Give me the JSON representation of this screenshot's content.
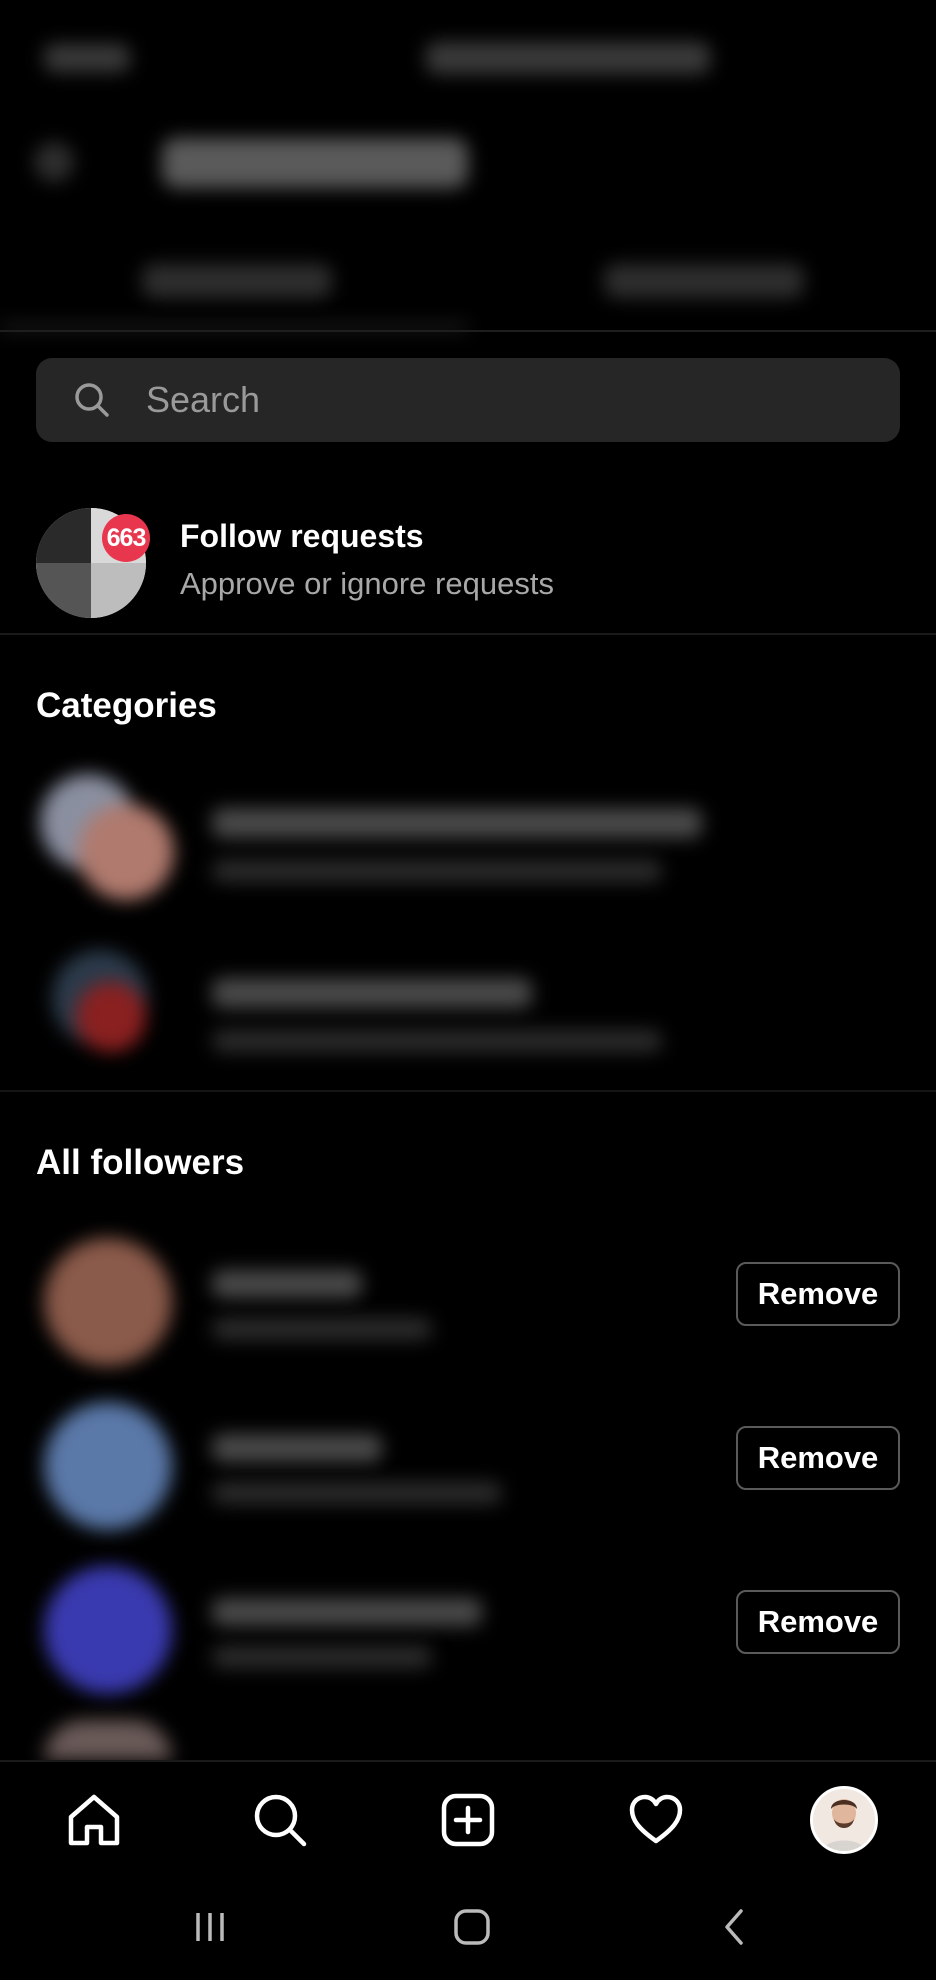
{
  "search": {
    "placeholder": "Search"
  },
  "follow_requests": {
    "badge_count": "663",
    "title": "Follow requests",
    "subtitle": "Approve or ignore requests"
  },
  "sections": {
    "categories": "Categories",
    "all_followers": "All followers"
  },
  "followers": [
    {
      "action_label": "Remove"
    },
    {
      "action_label": "Remove"
    },
    {
      "action_label": "Remove"
    }
  ],
  "bottom_nav": {
    "items": [
      "home-icon",
      "search-icon",
      "create-post-icon",
      "heart-icon",
      "profile-avatar"
    ]
  },
  "system_nav": {
    "items": [
      "recents-icon",
      "home-button-icon",
      "back-icon"
    ]
  },
  "colors": {
    "background": "#000000",
    "badge": "#e8364e",
    "search_bg": "#262626",
    "secondary_text": "#a8a8a8"
  }
}
